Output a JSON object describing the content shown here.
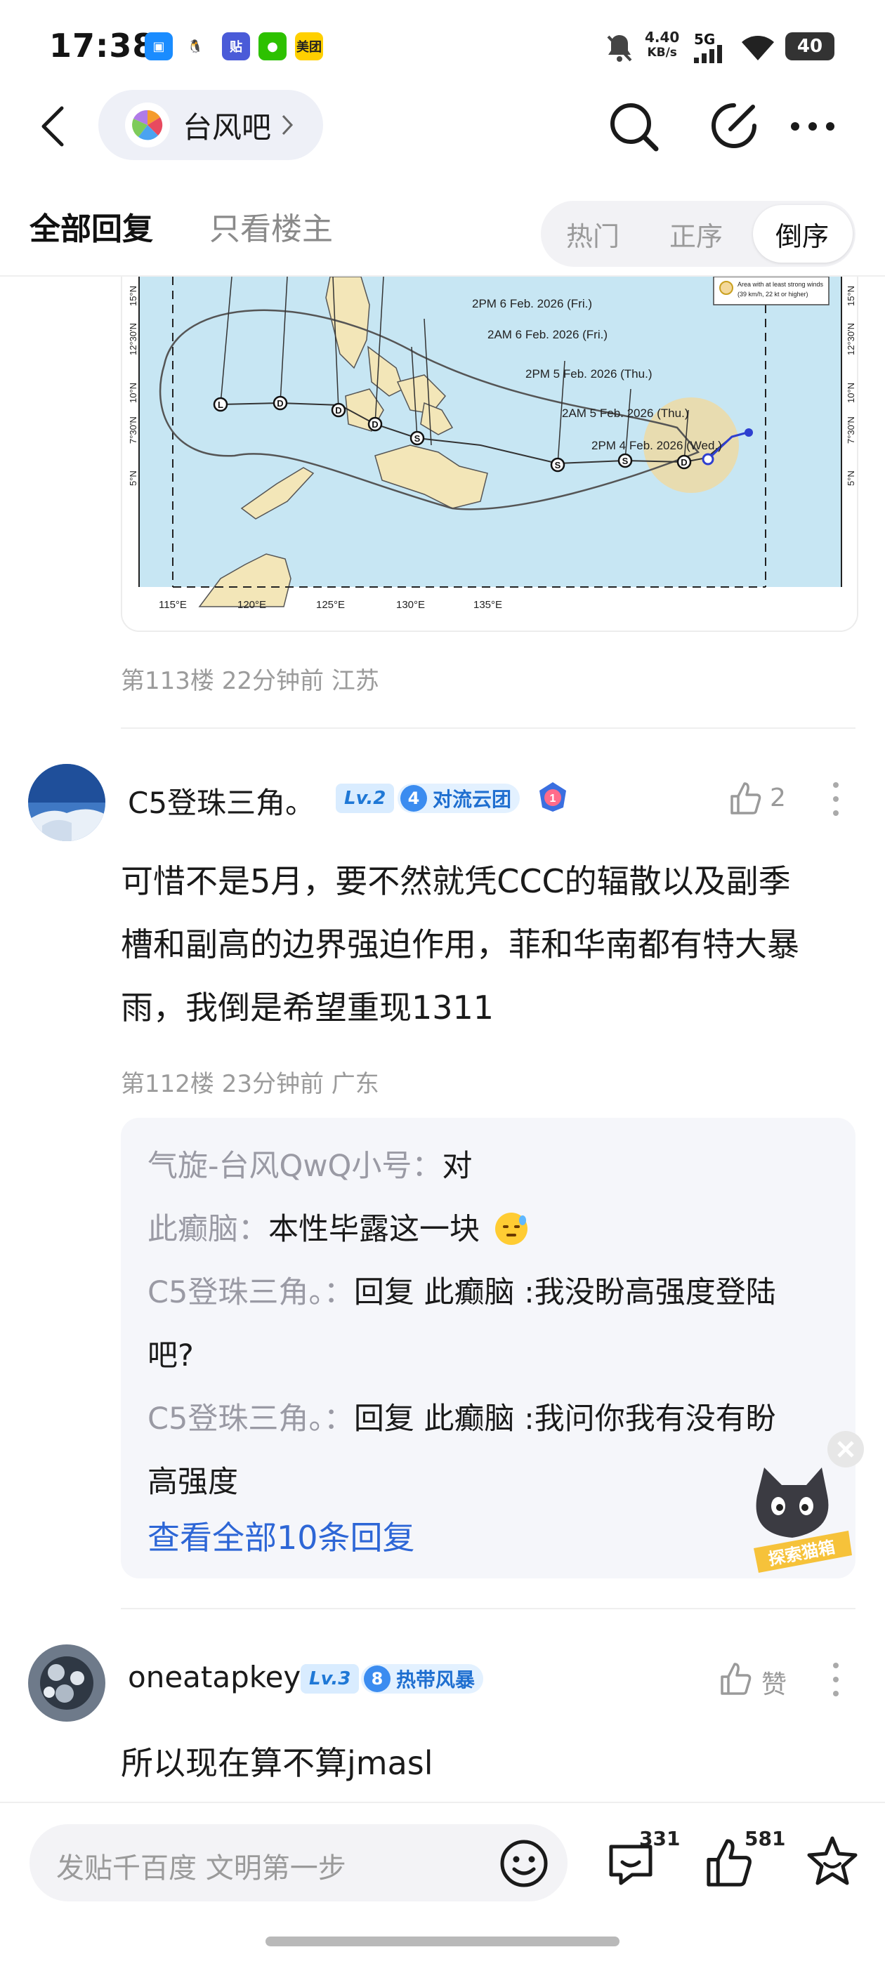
{
  "status_bar": {
    "time": "17:38",
    "app_icons": [
      {
        "name": "browser-app-icon",
        "color": "#1a8cff",
        "glyph": "▣"
      },
      {
        "name": "qq-app-icon",
        "color": "#ffffff",
        "glyph": "🐧"
      },
      {
        "name": "tieba-app-icon",
        "color": "#4a5bd8",
        "glyph": "贴"
      },
      {
        "name": "wechat-app-icon",
        "color": "#2dc100",
        "glyph": "●"
      },
      {
        "name": "meituan-app-icon",
        "color": "#ffd000",
        "glyph": "美团"
      }
    ],
    "net_speed_value": "4.40",
    "net_speed_unit": "KB/s",
    "signal_label": "5G",
    "battery": "40"
  },
  "header": {
    "forum_name": "台风吧",
    "icons": [
      "back-arrow-icon",
      "search-icon",
      "compose-icon",
      "more-icon"
    ]
  },
  "tabs": {
    "all_replies": "全部回复",
    "op_only": "只看楼主",
    "sort_hot": "热门",
    "sort_asc": "正序",
    "sort_desc": "倒序"
  },
  "map": {
    "lat_labels": [
      "15°N",
      "12°30'N",
      "10°N",
      "7°30'N",
      "5°N"
    ],
    "lon_labels": [
      "115°E",
      "120°E",
      "125°E",
      "130°E",
      "135°E"
    ],
    "forecast_labels": [
      "2PM 6 Feb. 2026 (Fri.)",
      "2AM 6 Feb. 2026 (Fri.)",
      "2PM 5 Feb. 2026 (Thu.)",
      "2AM 5 Feb. 2026 (Thu.)",
      "2PM 4 Feb. 2026 (Wed.)"
    ],
    "legend_text_1": "Area with at least strong winds",
    "legend_text_2": "(39 km/h, 22 kt or higher)",
    "track_markers": [
      "L",
      "D",
      "D",
      "D",
      "S",
      "S",
      "S",
      "D"
    ]
  },
  "posts": [
    {
      "meta": "第113楼  22分钟前  江苏"
    },
    {
      "username": "C5登珠三角。",
      "level": "Lv.2",
      "title_num": "4",
      "title_text": "对流云团",
      "rank_badge": "1",
      "likes": "2",
      "text_lines": [
        "可惜不是5月，要不然就凭CCC的辐散以及副季",
        "槽和副高的边界强迫作用，菲和华南都有特大暴",
        "雨，我倒是希望重现1311"
      ],
      "meta": "第112楼  23分钟前  广东",
      "replies": [
        {
          "author": "气旋-台风QwQ小号：",
          "text": "对"
        },
        {
          "author": "此癫脑：",
          "text": "本性毕露这一块"
        },
        {
          "author": "C5登珠三角。：",
          "text": "回复 此癫脑 :我没盼高强度登陆"
        },
        {
          "author": "",
          "text": "吧?"
        },
        {
          "author": "C5登珠三角。：",
          "text": "回复 此癫脑 :我问你我有没有盼"
        },
        {
          "author": "",
          "text": "高强度"
        }
      ],
      "view_all": "查看全部10条回复",
      "mascot_label": "探索猫箱"
    },
    {
      "username": "oneatapkey",
      "level": "Lv.3",
      "title_num": "8",
      "title_text": "热带风暴",
      "likes": "赞",
      "text_lines": [
        "所以现在算不算jmasl"
      ]
    }
  ],
  "bottom_bar": {
    "compose_placeholder": "发贴千百度 文明第一步",
    "comment_count": "331",
    "like_count": "581"
  },
  "colors": {
    "accent_blue": "#2d66d6",
    "sea": "#c7e6f3",
    "land": "#f3e6b8"
  }
}
